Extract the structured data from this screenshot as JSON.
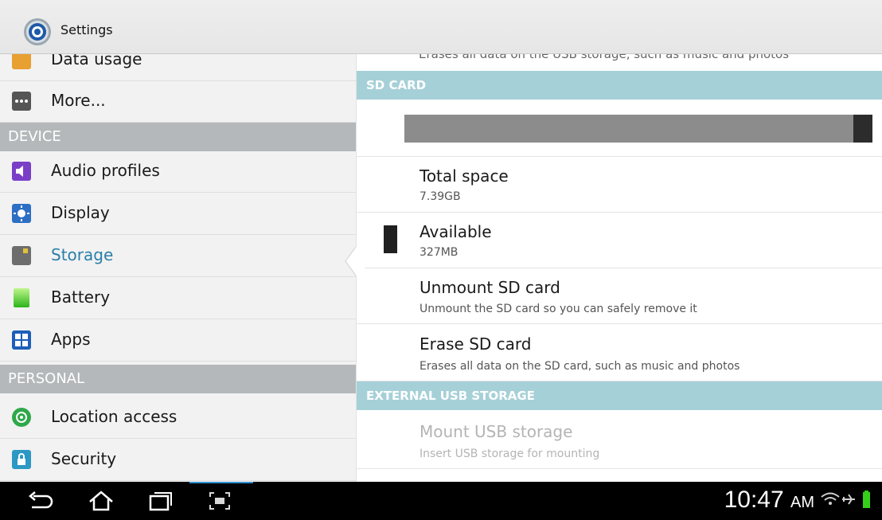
{
  "app": {
    "title": "Settings"
  },
  "left_menu": {
    "items_top": [
      {
        "label": "Data usage"
      },
      {
        "label": "More..."
      }
    ],
    "device_header": "DEVICE",
    "device_items": [
      {
        "label": "Audio profiles"
      },
      {
        "label": "Display"
      },
      {
        "label": "Storage"
      },
      {
        "label": "Battery"
      },
      {
        "label": "Apps"
      }
    ],
    "personal_header": "PERSONAL",
    "personal_items": [
      {
        "label": "Location access"
      },
      {
        "label": "Security"
      }
    ],
    "selected": "Storage"
  },
  "right": {
    "cut_summary": "Erases all data on the USB storage, such as music and photos",
    "sd_header": "SD CARD",
    "usage_bar": {
      "used_fraction": 0.96
    },
    "total_space": {
      "title": "Total space",
      "value": "7.39GB"
    },
    "available": {
      "title": "Available",
      "value": "327MB"
    },
    "unmount": {
      "title": "Unmount SD card",
      "summary": "Unmount the SD card so you can safely remove it"
    },
    "erase": {
      "title": "Erase SD card",
      "summary": "Erases all data on the SD card, such as music and photos"
    },
    "usb_header": "EXTERNAL USB STORAGE",
    "mount_usb": {
      "title": "Mount USB storage",
      "summary": "Insert USB storage for mounting"
    }
  },
  "navbar": {
    "time": "10:47",
    "ampm": "AM",
    "icons": [
      "back-icon",
      "home-icon",
      "recent-apps-icon",
      "screenshot-icon",
      "wifi-icon",
      "airplane-icon",
      "battery-icon"
    ]
  },
  "colors": {
    "section_header": "#a6d0d8",
    "left_header": "#b4b8ba",
    "selected_text": "#2a7fa8"
  }
}
